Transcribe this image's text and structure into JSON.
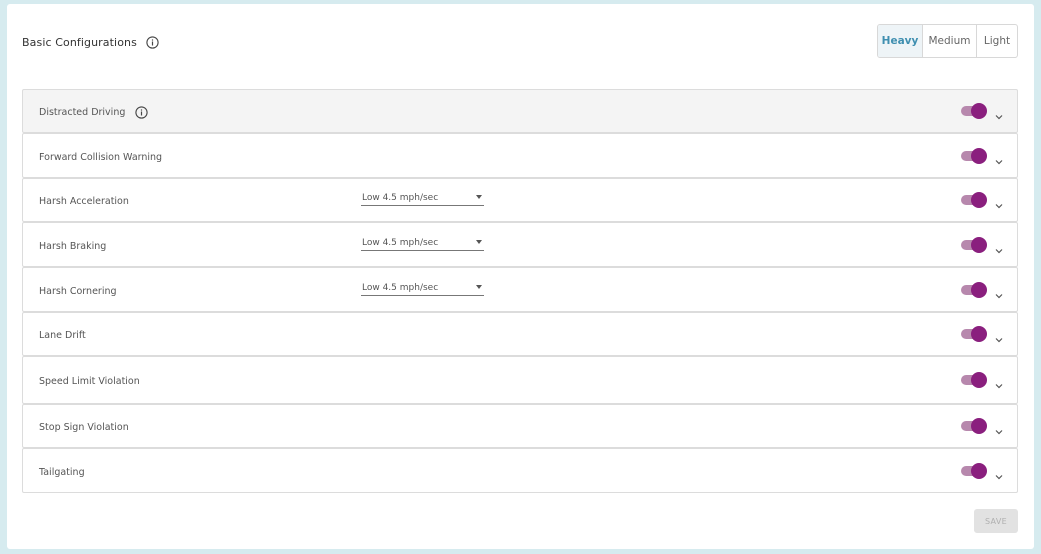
{
  "header": {
    "title": "Basic Configurations",
    "info_icon": "info-circle-icon"
  },
  "sensitivity": {
    "options": [
      "Heavy",
      "Medium",
      "Light"
    ],
    "selected": "Heavy",
    "active_color": "#3f8fb0"
  },
  "events": [
    {
      "label": "Distracted Driving",
      "has_info": true,
      "highlighted": true,
      "enabled": true,
      "threshold": null
    },
    {
      "label": "Forward Collision Warning",
      "has_info": false,
      "highlighted": false,
      "enabled": true,
      "threshold": null
    },
    {
      "label": "Harsh Acceleration",
      "has_info": false,
      "highlighted": false,
      "enabled": true,
      "threshold": "Low 4.5 mph/sec"
    },
    {
      "label": "Harsh Braking",
      "has_info": false,
      "highlighted": false,
      "enabled": true,
      "threshold": "Low 4.5 mph/sec"
    },
    {
      "label": "Harsh Cornering",
      "has_info": false,
      "highlighted": false,
      "enabled": true,
      "threshold": "Low 4.5 mph/sec"
    },
    {
      "label": "Lane Drift",
      "has_info": false,
      "highlighted": false,
      "enabled": true,
      "threshold": null
    },
    {
      "label": "Speed Limit Violation",
      "has_info": false,
      "highlighted": false,
      "enabled": true,
      "threshold": null
    },
    {
      "label": "Stop Sign Violation",
      "has_info": false,
      "highlighted": false,
      "enabled": true,
      "threshold": null
    },
    {
      "label": "Tailgating",
      "has_info": false,
      "highlighted": false,
      "enabled": true,
      "threshold": null
    }
  ],
  "toggle_colors": {
    "track": "#b788ad",
    "knob": "#8a1f7e"
  },
  "icons": {
    "expand": "chevron-down-icon",
    "info": "info-circle-icon"
  },
  "footer": {
    "save_label": "SAVE",
    "save_disabled": true
  }
}
